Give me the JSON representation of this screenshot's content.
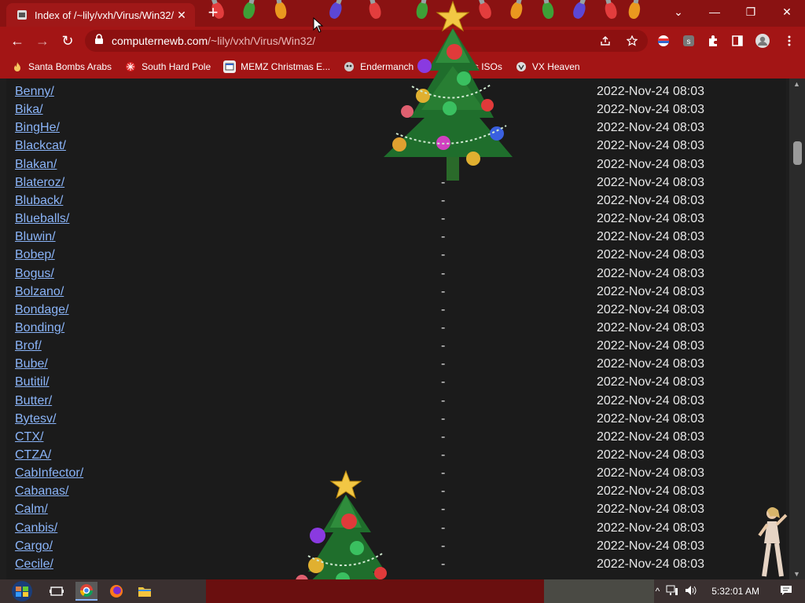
{
  "tab": {
    "title": "Index of /~lily/vxh/Virus/Win32/",
    "close": "✕",
    "new_tab": "+"
  },
  "window_controls": {
    "dropdown": "⌄",
    "minimize": "—",
    "restore": "❐",
    "close": "✕"
  },
  "nav": {
    "back": "←",
    "forward": "→",
    "reload": "↻"
  },
  "address": {
    "domain": "computernewb.com",
    "path": "/~lily/vxh/Virus/Win32/"
  },
  "bookmarks": [
    {
      "label": "Santa Bombs Arabs",
      "icon": "fire-icon"
    },
    {
      "label": "South Hard Pole",
      "icon": "snowflake-icon"
    },
    {
      "label": "MEMZ Christmas E...",
      "icon": "window-icon"
    },
    {
      "label": "Endermanch",
      "icon": "ender-icon"
    },
    {
      "label": "Windows ISOs",
      "icon": "blank-icon"
    },
    {
      "label": "VX Heaven",
      "icon": "vx-icon"
    }
  ],
  "listing": [
    {
      "name": "Benny/",
      "size": "",
      "date": "2022-Nov-24 08:03"
    },
    {
      "name": "Bika/",
      "size": "",
      "date": "2022-Nov-24 08:03"
    },
    {
      "name": "BingHe/",
      "size": "",
      "date": "2022-Nov-24 08:03"
    },
    {
      "name": "Blackcat/",
      "size": "",
      "date": "2022-Nov-24 08:03"
    },
    {
      "name": "Blakan/",
      "size": "",
      "date": "2022-Nov-24 08:03"
    },
    {
      "name": "Blateroz/",
      "size": "-",
      "date": "2022-Nov-24 08:03"
    },
    {
      "name": "Bluback/",
      "size": "-",
      "date": "2022-Nov-24 08:03"
    },
    {
      "name": "Blueballs/",
      "size": "-",
      "date": "2022-Nov-24 08:03"
    },
    {
      "name": "Bluwin/",
      "size": "-",
      "date": "2022-Nov-24 08:03"
    },
    {
      "name": "Bobep/",
      "size": "-",
      "date": "2022-Nov-24 08:03"
    },
    {
      "name": "Bogus/",
      "size": "-",
      "date": "2022-Nov-24 08:03"
    },
    {
      "name": "Bolzano/",
      "size": "-",
      "date": "2022-Nov-24 08:03"
    },
    {
      "name": "Bondage/",
      "size": "-",
      "date": "2022-Nov-24 08:03"
    },
    {
      "name": "Bonding/",
      "size": "-",
      "date": "2022-Nov-24 08:03"
    },
    {
      "name": "Brof/",
      "size": "-",
      "date": "2022-Nov-24 08:03"
    },
    {
      "name": "Bube/",
      "size": "-",
      "date": "2022-Nov-24 08:03"
    },
    {
      "name": "Butitil/",
      "size": "-",
      "date": "2022-Nov-24 08:03"
    },
    {
      "name": "Butter/",
      "size": "-",
      "date": "2022-Nov-24 08:03"
    },
    {
      "name": "Bytesv/",
      "size": "-",
      "date": "2022-Nov-24 08:03"
    },
    {
      "name": "CTX/",
      "size": "-",
      "date": "2022-Nov-24 08:03"
    },
    {
      "name": "CTZA/",
      "size": "-",
      "date": "2022-Nov-24 08:03"
    },
    {
      "name": "CabInfector/",
      "size": "-",
      "date": "2022-Nov-24 08:03"
    },
    {
      "name": "Cabanas/",
      "size": "-",
      "date": "2022-Nov-24 08:03"
    },
    {
      "name": "Calm/",
      "size": "-",
      "date": "2022-Nov-24 08:03"
    },
    {
      "name": "Canbis/",
      "size": "-",
      "date": "2022-Nov-24 08:03"
    },
    {
      "name": "Cargo/",
      "size": "-",
      "date": "2022-Nov-24 08:03"
    },
    {
      "name": "Cecile/",
      "size": "-",
      "date": "2022-Nov-24 08:03"
    }
  ],
  "taskbar": {
    "clock": "5:32:01 AM"
  },
  "colors": {
    "chrome_red": "#a31515",
    "tab_strip": "#8a1212",
    "link": "#8ab4f8",
    "page_bg": "#1b1b1b"
  }
}
